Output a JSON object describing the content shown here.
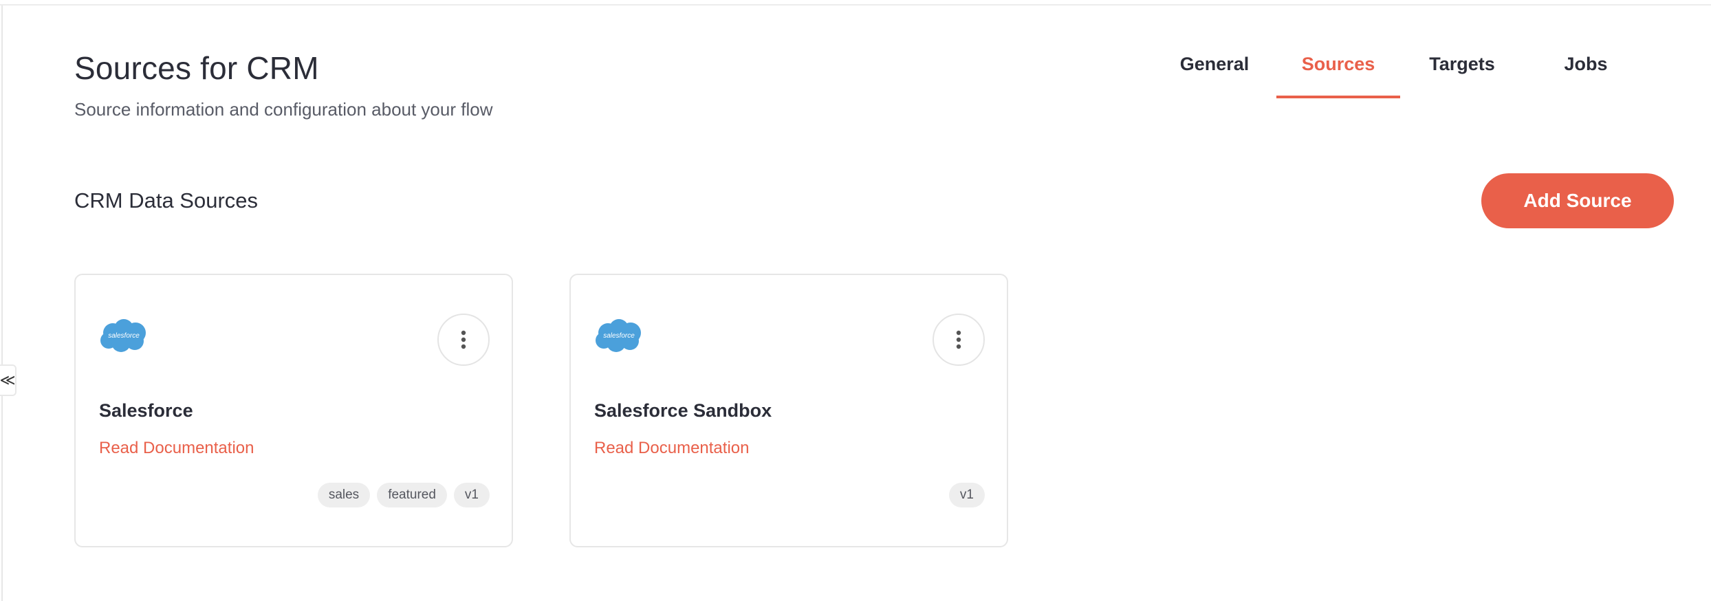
{
  "header": {
    "title": "Sources for CRM",
    "subtitle": "Source information and configuration about your flow"
  },
  "tabs": [
    {
      "label": "General",
      "active": false
    },
    {
      "label": "Sources",
      "active": true
    },
    {
      "label": "Targets",
      "active": false
    },
    {
      "label": "Jobs",
      "active": false
    }
  ],
  "section": {
    "title": "CRM Data Sources",
    "add_button_label": "Add Source"
  },
  "sources": [
    {
      "name": "Salesforce",
      "logo_text": "salesforce",
      "doc_link": "Read Documentation",
      "tags": [
        "sales",
        "featured",
        "v1"
      ]
    },
    {
      "name": "Salesforce Sandbox",
      "logo_text": "salesforce",
      "doc_link": "Read Documentation",
      "tags": [
        "v1"
      ]
    }
  ],
  "colors": {
    "accent": "#e9604a",
    "salesforce_blue": "#4ba0db",
    "text": "#2b2d38"
  },
  "icons": {
    "collapse": "collapse-left-icon",
    "menu": "kebab-menu-icon",
    "logo": "salesforce-cloud-logo"
  }
}
